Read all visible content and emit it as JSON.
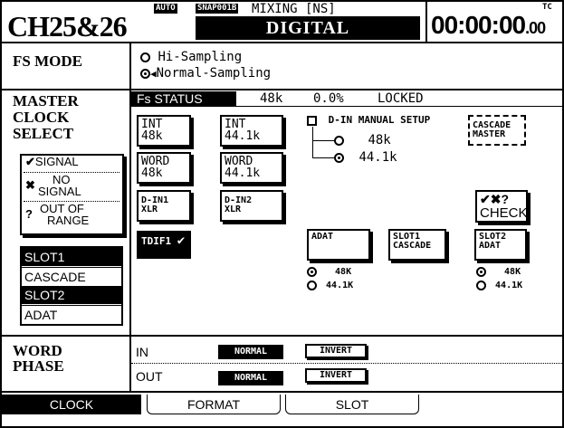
{
  "header": {
    "channel": "CH25&26",
    "auto_badge": "AUTO",
    "snap_badge": "SNAP001B",
    "mixing_label": "MIXING [NS]",
    "digital_label": "DIGITAL",
    "timecode": "00:00:00",
    "timecode_frames": ".00",
    "tc_label": "TC"
  },
  "fs_mode": {
    "title": "FS MODE",
    "options": [
      {
        "label": "Hi-Sampling",
        "selected": false
      },
      {
        "label": "Normal-Sampling",
        "selected": true
      }
    ]
  },
  "master_clock": {
    "title_1": "MASTER",
    "title_2": "CLOCK",
    "title_3": "SELECT",
    "fs_status_label": "Fs STATUS",
    "fs_rate": "48k",
    "fs_dev": "0.0%",
    "fs_lock": "LOCKED",
    "legend": {
      "signal": "SIGNAL",
      "no_signal_1": "NO",
      "no_signal_2": "SIGNAL",
      "out_of_range_1": "OUT OF",
      "out_of_range_2": "RANGE"
    },
    "slot_list": [
      {
        "label": "SLOT1",
        "selected": true
      },
      {
        "label": "CASCADE",
        "selected": false
      },
      {
        "label": "SLOT2",
        "selected": true
      },
      {
        "label": "ADAT",
        "selected": false
      }
    ],
    "sources": {
      "int48_1": "INT",
      "int48_2": "48k",
      "int441_1": "INT",
      "int441_2": "44.1k",
      "word48_1": "WORD",
      "word48_2": "48k",
      "word441_1": "WORD",
      "word441_2": "44.1k",
      "din1_1": "D-IN1",
      "din1_2": "XLR",
      "din2_1": "D-IN2",
      "din2_2": "XLR",
      "tdif1": "TDIF1",
      "adat": "ADAT",
      "slot1_cascade_1": "SLOT1",
      "slot1_cascade_2": "CASCADE",
      "slot2_adat_1": "SLOT2",
      "slot2_adat_2": "ADAT",
      "cascade_master_1": "CASCADE",
      "cascade_master_2": "MASTER"
    },
    "din_manual": {
      "label": "D-IN MANUAL SETUP",
      "opt_48": "48k",
      "opt_441": "44.1k"
    },
    "check_label": "CHECK",
    "check_icons": "✔✖?",
    "adat_rates": {
      "r48": "48K",
      "r441": "44.1K"
    },
    "slot2_rates": {
      "r48": "48K",
      "r441": "44.1K"
    }
  },
  "word_phase": {
    "title_1": "WORD",
    "title_2": "PHASE",
    "rows": [
      {
        "label": "IN",
        "normal": "NORMAL",
        "invert": "INVERT"
      },
      {
        "label": "OUT",
        "normal": "NORMAL",
        "invert": "INVERT"
      }
    ]
  },
  "tabs": [
    {
      "label": "CLOCK",
      "active": true
    },
    {
      "label": "FORMAT",
      "active": false
    },
    {
      "label": "SLOT",
      "active": false
    }
  ]
}
